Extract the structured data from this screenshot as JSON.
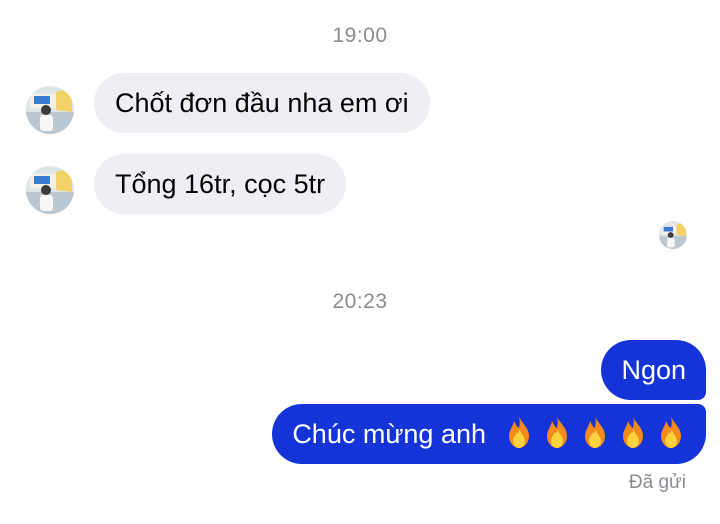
{
  "thread": {
    "timestamp_1": "19:00",
    "timestamp_2": "20:23",
    "messages": [
      {
        "direction": "incoming",
        "text": "Chốt đơn đầu nha em ơi"
      },
      {
        "direction": "incoming",
        "text": "Tổng 16tr, cọc 5tr"
      },
      {
        "direction": "outgoing",
        "text": "Ngon"
      },
      {
        "direction": "outgoing",
        "text": "Chúc mừng anh",
        "emoji_icons": [
          "fire-icon",
          "fire-icon",
          "fire-icon",
          "fire-icon",
          "fire-icon"
        ]
      }
    ],
    "status": "Đã gửi"
  },
  "colors": {
    "outgoing_bubble": "#1434d8",
    "incoming_bubble": "#efeff3",
    "timestamp_text": "#8a8d91"
  }
}
